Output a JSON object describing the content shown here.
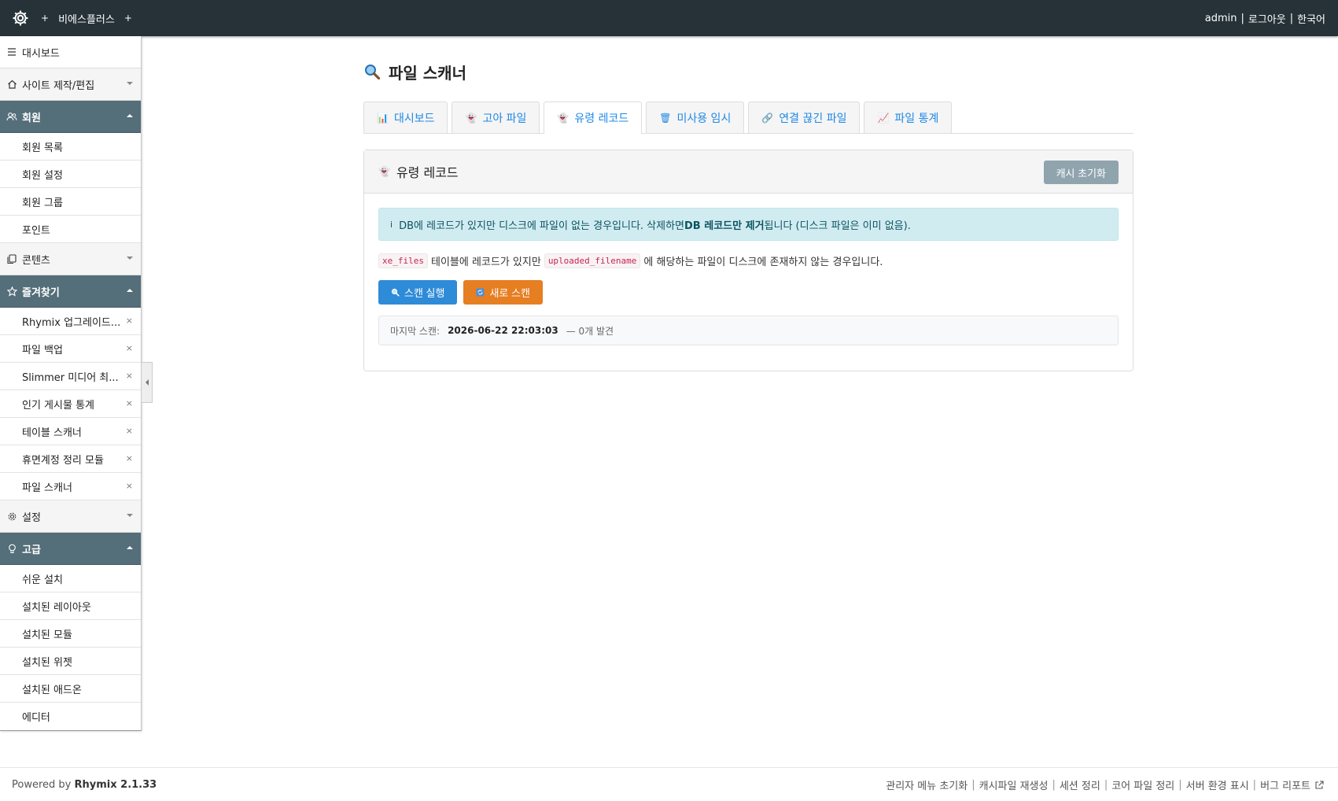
{
  "topbar": {
    "logo_icon": "gear-icon",
    "plus_left": "+",
    "site_name": "비에스플러스",
    "plus_right": "+",
    "user": "admin",
    "separator": "|",
    "logout": "로그아웃",
    "language": "한국어"
  },
  "sidebar": {
    "dashboard": "대시보드",
    "site_edit": "사이트 제작/편집",
    "member": {
      "label": "회원",
      "items": [
        "회원 목록",
        "회원 설정",
        "회원 그룹",
        "포인트"
      ]
    },
    "contents": "콘텐츠",
    "favorites": {
      "label": "즐겨찾기",
      "items": [
        "Rhymix 업그레이드...",
        "파일 백업",
        "Slimmer 미디어 최...",
        "인기 게시물 통계",
        "테이블 스캐너",
        "휴면계정 정리 모듈",
        "파일 스캐너"
      ],
      "remove_glyph": "×"
    },
    "settings": "설정",
    "advanced": {
      "label": "고급",
      "items": [
        "쉬운 설치",
        "설치된 레이아웃",
        "설치된 모듈",
        "설치된 위젯",
        "설치된 애드온",
        "에디터"
      ]
    }
  },
  "main": {
    "title": "파일 스캐너",
    "tabs": [
      {
        "icon": "📊",
        "label": "대시보드"
      },
      {
        "icon": "👻",
        "label": "고아 파일"
      },
      {
        "icon": "👻",
        "label": "유령 레코드"
      },
      {
        "icon": "🗑",
        "label": "미사용 임시"
      },
      {
        "icon": "🔗",
        "label": "연결 끊긴 파일"
      },
      {
        "icon": "📈",
        "label": "파일 통계"
      }
    ],
    "active_tab": 2,
    "panel": {
      "title_icon": "👻",
      "title": "유령 레코드",
      "cache_button": "캐시 초기화",
      "alert": {
        "icon": "i",
        "text_before": "DB에 레코드가 있지만 디스크에 파일이 없는 경우입니다. 삭제하면 ",
        "text_bold": "DB 레코드만 제거",
        "text_after": "됩니다 (디스크 파일은 이미 없음)."
      },
      "desc": {
        "code1": "xe_files",
        "text1": "테이블에 레코드가 있지만",
        "code2": "uploaded_filename",
        "text2": "에 해당하는 파일이 디스크에 존재하지 않는 경우입니다."
      },
      "scan_button": "스캔 실행",
      "rescan_button": "새로 스캔",
      "last_scan_label": "마지막 스캔:",
      "last_scan_date": "2026-06-22 22:03:03",
      "last_scan_result": "— 0개 발견"
    }
  },
  "footer": {
    "powered_prefix": "Powered by",
    "powered_name": "Rhymix 2.1.33",
    "links": [
      "관리자 메뉴 초기화",
      "캐시파일 재생성",
      "세션 정리",
      "코어 파일 정리",
      "서버 환경 표시",
      "버그 리포트"
    ]
  },
  "colors": {
    "topbar_bg": "#263238",
    "sidebar_open_bg": "#546e7a",
    "tab_link": "#1e88e5",
    "btn_scan": "#2e8bd8",
    "btn_rescan": "#e67e22",
    "btn_cache": "#90a4ae",
    "alert_bg": "#d1ecf1"
  }
}
